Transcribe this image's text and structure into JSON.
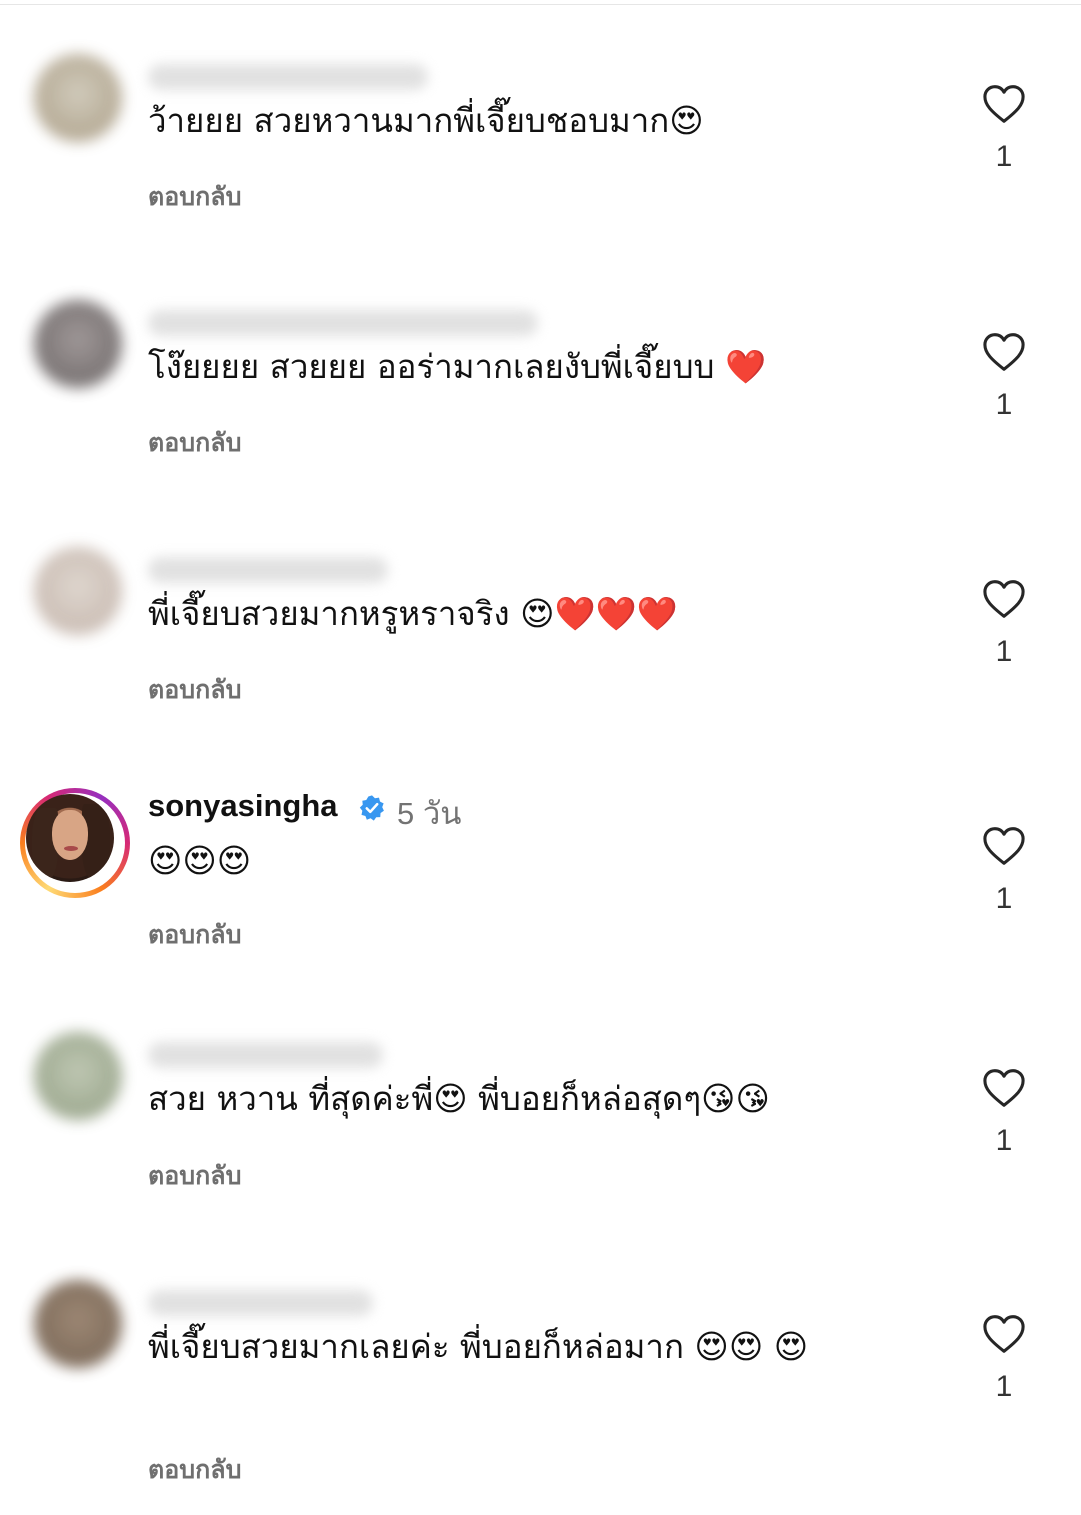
{
  "reply_label": "ตอบกลับ",
  "comments": [
    {
      "avatar_colors": [
        "#9a8a6e",
        "#c9c2b0"
      ],
      "username_hidden": true,
      "text": "ว้ายยย สวยหวานมากพี่เจี๊ยบชอบมาก😍",
      "likes": "1"
    },
    {
      "avatar_colors": [
        "#4e4848",
        "#8f8686"
      ],
      "username_hidden": true,
      "text": "โง๊ยยยย สวยยย ออร่ามากเลยงับพี่เจี๊ยบบ ❤️",
      "likes": "1"
    },
    {
      "avatar_colors": [
        "#b8a69b",
        "#d9cfc6"
      ],
      "username_hidden": true,
      "text": "พี่เจี๊ยบสวยมากหรูหราจริง 😍❤️❤️❤️",
      "likes": "1"
    },
    {
      "username": "sonyasingha",
      "verified": true,
      "time": "5 วัน",
      "text": "😍😍😍",
      "likes": "1"
    },
    {
      "avatar_colors": [
        "#7d8c6c",
        "#b4bea6"
      ],
      "username_hidden": true,
      "text": "สวย หวาน ที่สุดค่ะพี่😍 พี่บอยก็หล่อสุดๆ😘😘",
      "likes": "1"
    },
    {
      "avatar_colors": [
        "#5a4634",
        "#8c735c"
      ],
      "username_hidden": true,
      "text": "พี่เจี๊ยบสวยมากเลยค่ะ พี่บอยก็หล่อมาก 😍😍 😍",
      "likes": "1"
    }
  ],
  "colors": {
    "verified_badge": "#3897f0",
    "secondary_text": "#737373",
    "story_ring": [
      "#feda75",
      "#fa7e1e",
      "#d62976",
      "#962fbf"
    ]
  },
  "icons": {
    "like": "heart-outline-icon",
    "verified": "verified-badge-icon"
  }
}
